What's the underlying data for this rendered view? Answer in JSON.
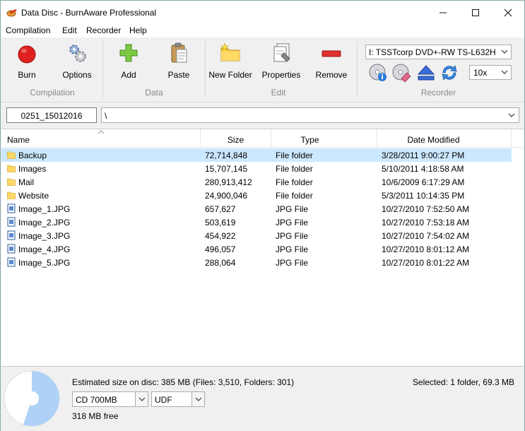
{
  "window": {
    "title": "Data Disc - BurnAware Professional"
  },
  "menu": [
    "Compilation",
    "Edit",
    "Recorder",
    "Help"
  ],
  "ribbon": {
    "burn": "Burn",
    "options": "Options",
    "add": "Add",
    "paste": "Paste",
    "new_folder": "New Folder",
    "properties": "Properties",
    "remove": "Remove",
    "groups": {
      "compilation": "Compilation",
      "data": "Data",
      "edit": "Edit",
      "recorder": "Recorder"
    },
    "drive": "I: TSSTcorp DVD+-RW TS-L632H",
    "speed": "10x"
  },
  "path": {
    "disc_label": "0251_15012016",
    "current": "\\"
  },
  "columns": [
    "Name",
    "Size",
    "Type",
    "Date Modified"
  ],
  "rows": [
    {
      "name": "Backup",
      "size": "72,714,848",
      "type": "File folder",
      "date": "3/28/2011 9:00:27 PM",
      "kind": "folder",
      "selected": true
    },
    {
      "name": "Images",
      "size": "15,707,145",
      "type": "File folder",
      "date": "5/10/2011 4:18:58 AM",
      "kind": "folder",
      "selected": false
    },
    {
      "name": "Mail",
      "size": "280,913,412",
      "type": "File folder",
      "date": "10/6/2009 6:17:29 AM",
      "kind": "folder",
      "selected": false
    },
    {
      "name": "Website",
      "size": "24,900,046",
      "type": "File folder",
      "date": "5/3/2011 10:14:35 PM",
      "kind": "folder",
      "selected": false
    },
    {
      "name": "Image_1.JPG",
      "size": "657,627",
      "type": "JPG File",
      "date": "10/27/2010 7:52:50 AM",
      "kind": "image",
      "selected": false
    },
    {
      "name": "Image_2.JPG",
      "size": "503,619",
      "type": "JPG File",
      "date": "10/27/2010 7:53:18 AM",
      "kind": "image",
      "selected": false
    },
    {
      "name": "Image_3.JPG",
      "size": "454,922",
      "type": "JPG File",
      "date": "10/27/2010 7:54:02 AM",
      "kind": "image",
      "selected": false
    },
    {
      "name": "Image_4.JPG",
      "size": "496,057",
      "type": "JPG File",
      "date": "10/27/2010 8:01:12 AM",
      "kind": "image",
      "selected": false
    },
    {
      "name": "Image_5.JPG",
      "size": "288,064",
      "type": "JPG File",
      "date": "10/27/2010 8:01:22 AM",
      "kind": "image",
      "selected": false
    }
  ],
  "status": {
    "estimated": "Estimated size on disc: 385 MB (Files: 3,510, Folders: 301)",
    "selected": "Selected: 1 folder, 69.3 MB",
    "disc_type": "CD 700MB",
    "file_system": "UDF",
    "free": "318 MB free",
    "used_fraction": 0.55
  },
  "colors": {
    "selection": "#cce8ff",
    "pie_used": "#aed2f7",
    "folder": "#ffd866",
    "burn": "#e02020",
    "add": "#7ac943",
    "remove": "#e03030"
  }
}
